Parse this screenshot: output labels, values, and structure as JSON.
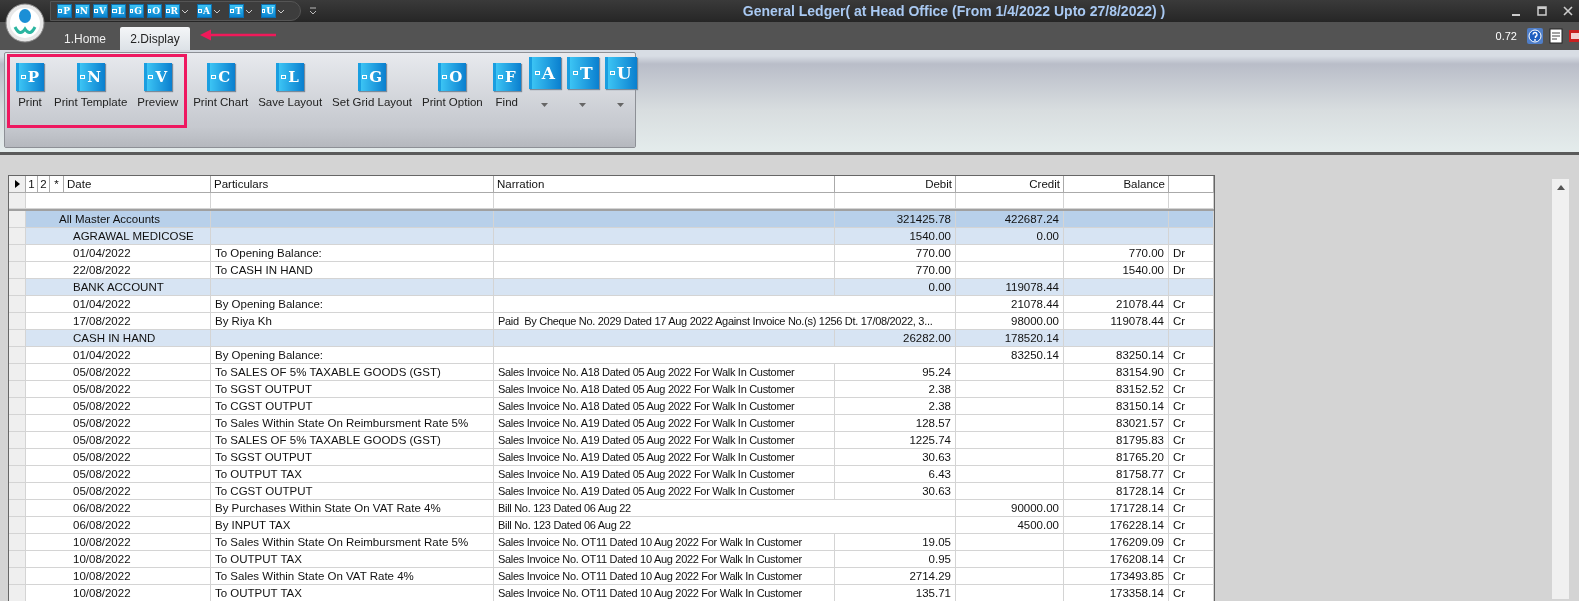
{
  "window": {
    "title": "General Ledger( at Head Office  (From 1/4/2022 Upto 27/8/2022) )"
  },
  "quick_access": [
    {
      "letter": "P",
      "dropdown": false
    },
    {
      "letter": "N",
      "dropdown": false
    },
    {
      "letter": "V",
      "dropdown": false
    },
    {
      "letter": "L",
      "dropdown": false
    },
    {
      "letter": "G",
      "dropdown": false
    },
    {
      "letter": "O",
      "dropdown": false
    },
    {
      "letter": "R",
      "dropdown": true
    },
    {
      "letter": "A",
      "dropdown": true
    },
    {
      "letter": "T",
      "dropdown": true
    },
    {
      "letter": "U",
      "dropdown": true
    }
  ],
  "tabs": [
    {
      "label": "1.Home",
      "selected": false
    },
    {
      "label": "2.Display",
      "selected": true
    }
  ],
  "zoom_value": "0.72",
  "ribbon": [
    {
      "letter": "P",
      "label": "Print",
      "dropdown": false,
      "highlighted": true
    },
    {
      "letter": "N",
      "label": "Print Template",
      "dropdown": false,
      "highlighted": true
    },
    {
      "letter": "V",
      "label": "Preview",
      "dropdown": false,
      "highlighted": true
    },
    {
      "letter": "C",
      "label": "Print Chart",
      "dropdown": false,
      "highlighted": false
    },
    {
      "letter": "L",
      "label": "Save Layout",
      "dropdown": false,
      "highlighted": false
    },
    {
      "letter": "G",
      "label": "Set Grid Layout",
      "dropdown": false,
      "highlighted": false
    },
    {
      "letter": "O",
      "label": "Print Option",
      "dropdown": false,
      "highlighted": false
    },
    {
      "letter": "F",
      "label": "Find",
      "dropdown": false,
      "highlighted": false
    },
    {
      "letter": "A",
      "dropdown": true,
      "highlighted": false
    },
    {
      "letter": "T",
      "dropdown": true,
      "highlighted": false
    },
    {
      "letter": "U",
      "dropdown": true,
      "highlighted": false
    }
  ],
  "table": {
    "band_labels": [
      "1",
      "2",
      "*"
    ],
    "columns": [
      "Date",
      "Particulars",
      "Narration",
      "Debit",
      "Credit",
      "Balance"
    ],
    "total": {
      "label": "All Master Accounts",
      "debit": "321425.78",
      "credit": "422687.24",
      "children": [
        {
          "label": "AGRAWAL MEDICOSE",
          "debit": "1540.00",
          "credit": "0.00",
          "children": [
            {
              "date": "01/04/2022",
              "particulars": "To Opening Balance:",
              "debit": "770.00",
              "balance": "770.00",
              "side": "Dr"
            },
            {
              "date": "22/08/2022",
              "particulars": "To CASH IN HAND",
              "debit": "770.00",
              "balance": "1540.00",
              "side": "Dr"
            }
          ]
        },
        {
          "label": "BANK ACCOUNT",
          "debit": "0.00",
          "credit": "119078.44",
          "children": [
            {
              "date": "01/04/2022",
              "particulars": "By Opening Balance:",
              "credit": "21078.44",
              "balance": "21078.44",
              "side": "Cr"
            },
            {
              "date": "17/08/2022",
              "particulars": "By Riya Kh",
              "narration": "Paid  By Cheque No. 2029 Dated 17 Aug 2022 Against Invoice No.(s) 1256 Dt. 17/08/2022, 3...",
              "credit": "98000.00",
              "balance": "119078.44",
              "side": "Cr"
            }
          ]
        },
        {
          "label": "CASH IN HAND",
          "debit": "26282.00",
          "credit": "178520.14",
          "children": [
            {
              "date": "01/04/2022",
              "particulars": "By Opening Balance:",
              "credit": "83250.14",
              "balance": "83250.14",
              "side": "Cr"
            },
            {
              "date": "05/08/2022",
              "particulars": "To SALES OF 5% TAXABLE GOODS (GST)",
              "narration": "Sales Invoice No. A18 Dated 05 Aug 2022 For Walk In Customer",
              "debit": "95.24",
              "balance": "83154.90",
              "side": "Cr"
            },
            {
              "date": "05/08/2022",
              "particulars": "To SGST OUTPUT",
              "narration": "Sales Invoice No. A18 Dated 05 Aug 2022 For Walk In Customer",
              "debit": "2.38",
              "balance": "83152.52",
              "side": "Cr"
            },
            {
              "date": "05/08/2022",
              "particulars": "To CGST OUTPUT",
              "narration": "Sales Invoice No. A18 Dated 05 Aug 2022 For Walk In Customer",
              "debit": "2.38",
              "balance": "83150.14",
              "side": "Cr"
            },
            {
              "date": "05/08/2022",
              "particulars": "To Sales Within State On Reimbursment Rate 5%",
              "narration": "Sales Invoice No. A19 Dated 05 Aug 2022 For Walk In Customer",
              "debit": "128.57",
              "balance": "83021.57",
              "side": "Cr"
            },
            {
              "date": "05/08/2022",
              "particulars": "To SALES OF 5% TAXABLE GOODS (GST)",
              "narration": "Sales Invoice No. A19 Dated 05 Aug 2022 For Walk In Customer",
              "debit": "1225.74",
              "balance": "81795.83",
              "side": "Cr"
            },
            {
              "date": "05/08/2022",
              "particulars": "To SGST OUTPUT",
              "narration": "Sales Invoice No. A19 Dated 05 Aug 2022 For Walk In Customer",
              "debit": "30.63",
              "balance": "81765.20",
              "side": "Cr"
            },
            {
              "date": "05/08/2022",
              "particulars": "To OUTPUT TAX",
              "narration": "Sales Invoice No. A19 Dated 05 Aug 2022 For Walk In Customer",
              "debit": "6.43",
              "balance": "81758.77",
              "side": "Cr"
            },
            {
              "date": "05/08/2022",
              "particulars": "To CGST OUTPUT",
              "narration": "Sales Invoice No. A19 Dated 05 Aug 2022 For Walk In Customer",
              "debit": "30.63",
              "balance": "81728.14",
              "side": "Cr"
            },
            {
              "date": "06/08/2022",
              "particulars": "By Purchases Within State On VAT Rate 4%",
              "narration": "Bill No. 123 Dated 06 Aug 22",
              "credit": "90000.00",
              "balance": "171728.14",
              "side": "Cr"
            },
            {
              "date": "06/08/2022",
              "particulars": "By INPUT TAX",
              "narration": "Bill No. 123 Dated 06 Aug 22",
              "credit": "4500.00",
              "balance": "176228.14",
              "side": "Cr"
            },
            {
              "date": "10/08/2022",
              "particulars": "To Sales Within State On Reimbursment Rate 5%",
              "narration": "Sales Invoice No. OT11 Dated 10 Aug 2022 For Walk In Customer",
              "debit": "19.05",
              "balance": "176209.09",
              "side": "Cr"
            },
            {
              "date": "10/08/2022",
              "particulars": "To OUTPUT TAX",
              "narration": "Sales Invoice No. OT11 Dated 10 Aug 2022 For Walk In Customer",
              "debit": "0.95",
              "balance": "176208.14",
              "side": "Cr"
            },
            {
              "date": "10/08/2022",
              "particulars": "To Sales Within State On VAT Rate 4%",
              "narration": "Sales Invoice No. OT11 Dated 10 Aug 2022 For Walk In Customer",
              "debit": "2714.29",
              "balance": "173493.85",
              "side": "Cr"
            },
            {
              "date": "10/08/2022",
              "particulars": "To OUTPUT TAX",
              "narration": "Sales Invoice No. OT11 Dated 10 Aug 2022 For Walk In Customer",
              "debit": "135.71",
              "balance": "173358.14",
              "side": "Cr"
            }
          ]
        }
      ]
    }
  }
}
